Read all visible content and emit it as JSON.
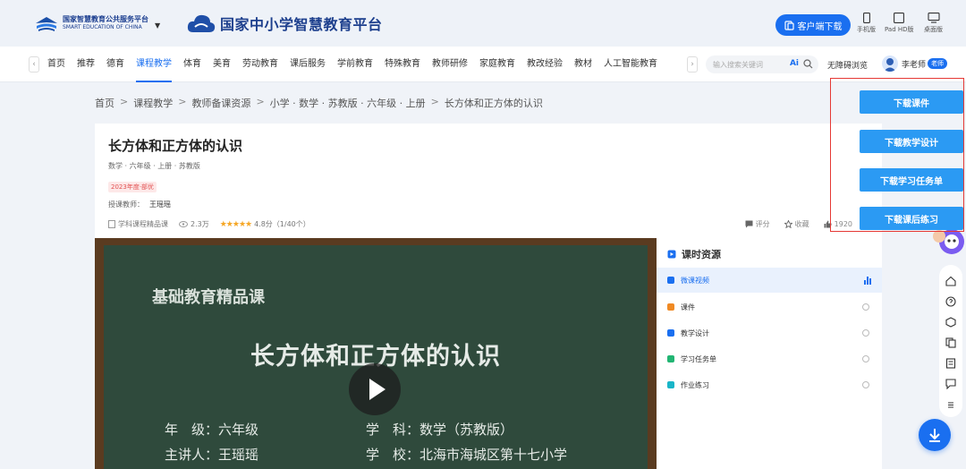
{
  "header": {
    "logo1_cn": "国家智慧教育公共服务平台",
    "logo1_en": "SMART EDUCATION OF CHINA",
    "platform_title": "国家中小学智慧教育平台",
    "client_download": "客户端下载",
    "devices": [
      {
        "label": "手机版",
        "icon": "phone-icon"
      },
      {
        "label": "Pad HD版",
        "icon": "tablet-icon"
      },
      {
        "label": "桌面版",
        "icon": "desktop-icon"
      }
    ]
  },
  "nav": {
    "items": [
      "首页",
      "推荐",
      "德育",
      "课程教学",
      "体育",
      "美育",
      "劳动教育",
      "课后服务",
      "学前教育",
      "特殊教育",
      "教师研修",
      "家庭教育",
      "教改经验",
      "教材",
      "人工智能教育"
    ],
    "active": "课程教学",
    "search_placeholder": "输入搜索关键词",
    "ai_label": "Ai",
    "accessibility": "无障碍浏览",
    "user_name": "李老师",
    "user_role": "老师"
  },
  "breadcrumb": [
    "首页",
    "课程教学",
    "教师备课资源",
    "小学 · 数学 · 苏教版 · 六年级 · 上册",
    "长方体和正方体的认识"
  ],
  "lesson": {
    "title": "长方体和正方体的认识",
    "meta": "数学 · 六年级 · 上册 · 苏教版",
    "tag": "2023年度·部优",
    "teacher_label": "授课教师：",
    "teacher": "王瑶瑶",
    "type": "学科课程精品课",
    "views": "2.3万",
    "rating": 4.8,
    "rating_text": "4.8分（1/40个）",
    "actions": {
      "comment": "评分",
      "favorite": "收藏",
      "likes": "1920"
    }
  },
  "video": {
    "heading": "基础教育精品课",
    "title": "长方体和正方体的认识",
    "grade_label": "年　级：六年级",
    "subject_label": "学　科：数学（苏教版）",
    "lecturer_label": "主讲人：王瑶瑶",
    "school_label": "学　校：北海市海城区第十七小学"
  },
  "resources": {
    "title": "课时资源",
    "items": [
      {
        "label": "微课视频",
        "color": "#1a6ff0",
        "active": true
      },
      {
        "label": "课件",
        "color": "#f08a24",
        "active": false
      },
      {
        "label": "教学设计",
        "color": "#1a6ff0",
        "active": false
      },
      {
        "label": "学习任务单",
        "color": "#22b573",
        "active": false
      },
      {
        "label": "作业练习",
        "color": "#19b5c8",
        "active": false
      }
    ]
  },
  "downloads": [
    "下载课件",
    "下载教学设计",
    "下载学习任务单",
    "下载课后练习"
  ],
  "colors": {
    "accent": "#1a6ff0",
    "download": "#2b9af3",
    "highlight_box": "#e53935"
  }
}
